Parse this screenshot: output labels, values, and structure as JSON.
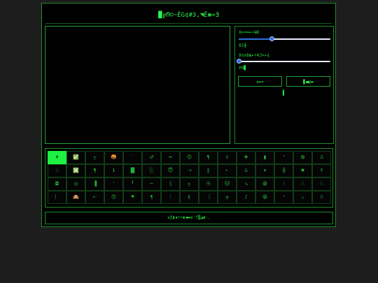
{
  "app": {
    "title": "█╔ﬂ©~ÈG¢#Ͽ,◥Ё✽=Ǝ"
  },
  "controls": {
    "slider1": {
      "label": "X∞¤═▸≈ä₪",
      "value_text": "83┣",
      "value": 0.36
    },
    "slider2": {
      "label": "9ℌℓ8▮▸+4ℑ☂▸¢",
      "value_text": "¥0▊",
      "value": 0.0
    },
    "button1_label": "≡∞¤",
    "button2_label": "▋◼◧▬",
    "status": "▌"
  },
  "glyph_grid": {
    "selected_index": 0,
    "rows": [
      [
        "♦",
        "✅",
        "┬",
        "🤬",
        "ˊ",
        "♂",
        "━",
        "😊",
        "¶",
        "ᛄ",
        "❖",
        "▮",
        "⁷",
        "✿",
        "♙"
      ],
      [
        "♘",
        "❎",
        "¶",
        "ℹ",
        "█",
        "░",
        "😇",
        "⇢",
        "∥",
        "╸",
        "♙",
        "▾",
        "╬",
        "✸",
        "⇑"
      ],
      [
        "◘",
        "◎",
        "▐",
        "'",
        "╹",
        "~",
        "⦃",
        "╕",
        "㊉",
        "🐱",
        "➘",
        "😁",
        "⁝",
        "♘",
        "♘"
      ],
      [
        "〕",
        "🙈",
        "⇠",
        "😊",
        "⚑",
        "¶",
        "⁝",
        "❨",
        "〖",
        "╤",
        "♪",
        "😁",
        "⁺",
        "۞",
        "⁞⁞"
      ]
    ]
  },
  "footer": {
    "text": "ℯ╳▮◖÷¤▮◀▬≡⁽̈ᵖ▒◢▮◦◞"
  },
  "colors": {
    "accent": "#22e03a",
    "selected_cell": "#1df040",
    "slider": "#2f6fe0",
    "background": "#000000"
  }
}
